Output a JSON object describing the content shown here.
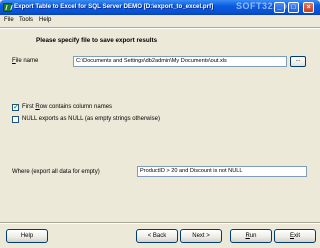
{
  "window": {
    "title": "Export Table to Excel for SQL Server DEMO [D:\\export_to_excel.prf]",
    "watermark": "SOFT32.com",
    "minimize_glyph": "_",
    "maximize_glyph": "□",
    "close_glyph": "×"
  },
  "menu": {
    "items": [
      "File",
      "Tools",
      "Help"
    ]
  },
  "main": {
    "heading": "Please specify file to save export results",
    "file_name_label_prefix": "F",
    "file_name_label_rest": "ile name",
    "file_name_value": "C:\\Documents and Settings\\db2admin\\My Documents\\out.xls",
    "browse_label": "...",
    "first_row_label_prefix": "First ",
    "first_row_label_accel": "R",
    "first_row_label_rest": "ow contains column names",
    "first_row_checked": true,
    "null_label": "NULL exports as NULL (as empty strings otherwise)",
    "null_checked": false,
    "where_label": "Where (export all data for empty)",
    "where_value": "ProductID > 20 and Discount is not NULL"
  },
  "footer": {
    "help_label": "Help",
    "back_label": "< Back",
    "next_label": "Next >",
    "run_prefix": "R",
    "run_rest": "un",
    "exit_prefix": "E",
    "exit_rest": "xit"
  },
  "colors": {
    "titlebar": "#0a5ce0",
    "window_bg": "#ece9d8",
    "input_border": "#7f9db9"
  }
}
